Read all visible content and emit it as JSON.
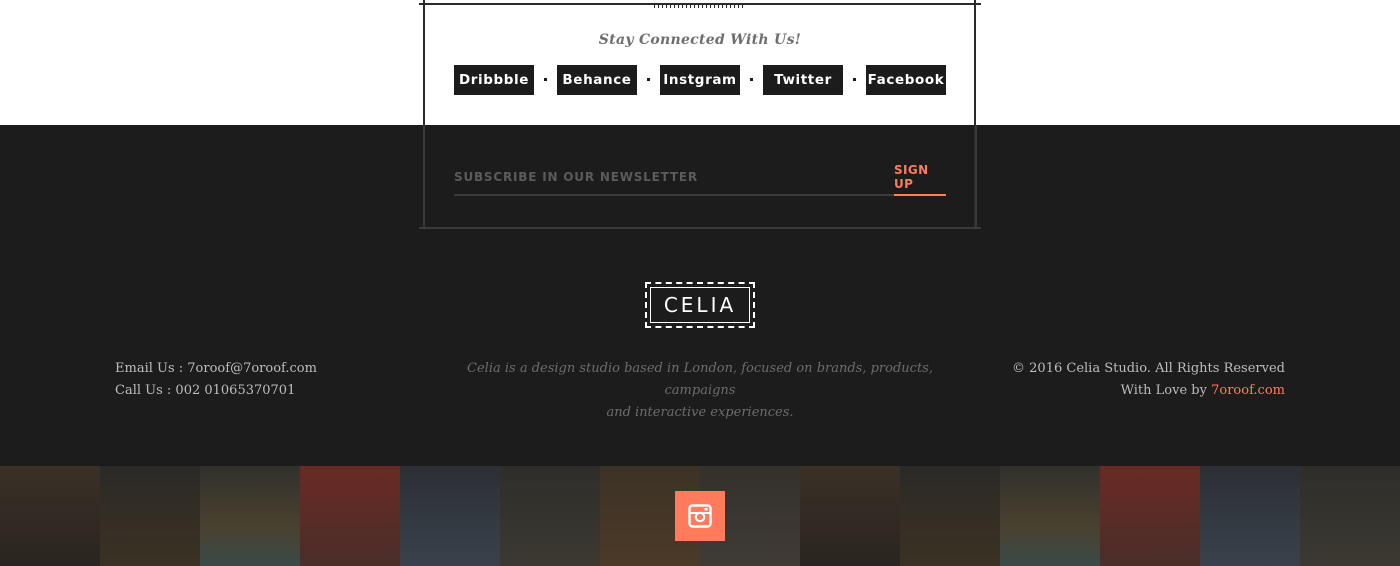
{
  "connect": {
    "heading": "Stay Connected With Us!",
    "links": [
      "Dribbble",
      "Behance",
      "Instgram",
      "Twitter",
      "Facebook"
    ]
  },
  "newsletter": {
    "placeholder": "SUBSCRIBE IN OUR NEWSLETTER",
    "button": "SIGN UP"
  },
  "logo": {
    "text": "CELIA"
  },
  "footer": {
    "email_line": "Email Us : 7oroof@7oroof.com",
    "phone_line": "Call Us : 002 01065370701",
    "description_line1": "Celia is a design studio based in London, focused on brands, products, campaigns",
    "description_line2": "and interactive experiences.",
    "copyright": "© 2016 Celia Studio. All Rights Reserved",
    "love_prefix": "With Love by",
    "love_link": "7oroof.com"
  },
  "colors": {
    "accent": "#ff7b5c",
    "dark_bg": "#1c1c1c",
    "button_bg": "#1c1c1c"
  },
  "instagram": {
    "icon": "instagram-icon"
  }
}
